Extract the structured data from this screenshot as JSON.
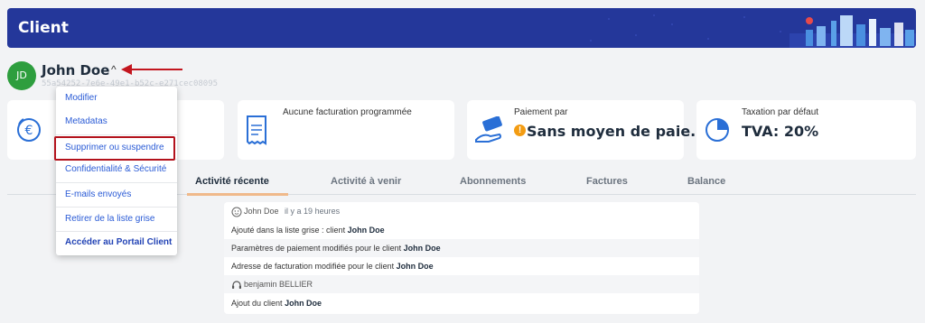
{
  "header": {
    "title": "Client"
  },
  "client": {
    "initials": "JD",
    "name": "John Doe",
    "caret": "^",
    "id": "55a54252-7e6e-49e1-b52c-e271cec08095"
  },
  "cards": [
    {
      "label": "",
      "value": "",
      "icon": "euro-icon"
    },
    {
      "label": "Aucune facturation programmée",
      "value": "",
      "icon": "invoice-icon"
    },
    {
      "label": "Paiement par",
      "value": "Sans moyen de paie...",
      "warning": "!",
      "icon": "payment-hand-icon"
    },
    {
      "label": "Taxation par défaut",
      "value": "TVA: 20%",
      "icon": "pie-chart-icon"
    }
  ],
  "tabs": [
    "Activité récente",
    "Activité à venir",
    "Abonnements",
    "Factures",
    "Balance"
  ],
  "feed": {
    "group1": {
      "author": "John Doe",
      "time": "il y a 19 heures"
    },
    "row1": {
      "text": "Ajouté dans la liste grise : client",
      "client": "John Doe"
    },
    "row2": {
      "text": "Paramètres de paiement modifiés pour le client",
      "client": "John Doe"
    },
    "row3": {
      "text": "Adresse de facturation modifiée pour le client",
      "client": "John Doe"
    },
    "group2": {
      "author": "benjamin BELLIER"
    },
    "row4": {
      "text": "Ajout du client",
      "client": "John Doe"
    }
  },
  "menu": {
    "items": [
      "Modifier",
      "Metadatas",
      "Supprimer ou suspendre",
      "Confidentialité & Sécurité",
      "E-mails envoyés",
      "Retirer de la liste grise",
      "Accéder au Portail Client"
    ]
  },
  "colors": {
    "banner": "#24379a",
    "avatar": "#2e9e3e",
    "link": "#2a5bd6",
    "highlight": "#b3121c",
    "warning": "#f39c12",
    "tab_underline": "#f0b98a"
  }
}
